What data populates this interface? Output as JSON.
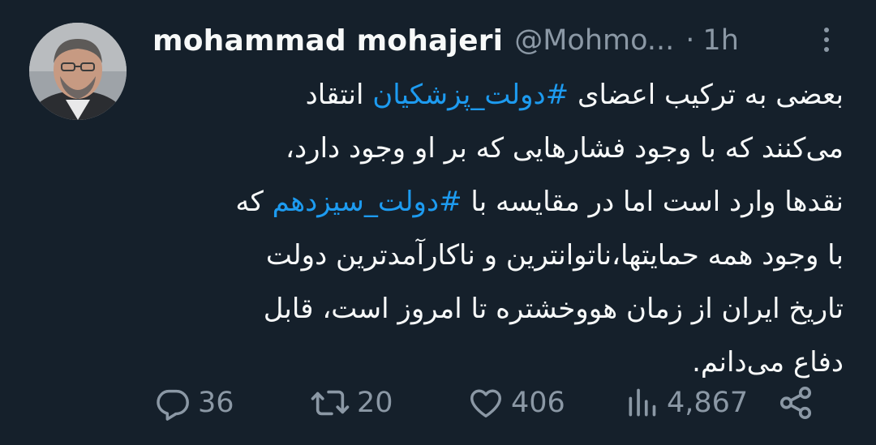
{
  "tweet": {
    "author_name": "mohammad mohajeri",
    "handle": "@Mohmo...",
    "separator": "·",
    "time": "1h",
    "lines": [
      [
        {
          "text": "بعضی به ترکیب اعضای ",
          "hashtag": false
        },
        {
          "text": "#دولت_پزشکیان",
          "hashtag": true
        },
        {
          "text": " انتقاد",
          "hashtag": false
        }
      ],
      [
        {
          "text": "می‌کنند که با وجود فشارهایی که بر او وجود دارد،",
          "hashtag": false
        }
      ],
      [
        {
          "text": "نقدها وارد است اما در مقایسه با ",
          "hashtag": false
        },
        {
          "text": "#دولت_سیزدهم",
          "hashtag": true
        },
        {
          "text": " که",
          "hashtag": false
        }
      ],
      [
        {
          "text": "با وجود همه حمایتها،ناتوانترین و ناکارآمدترین دولت",
          "hashtag": false
        }
      ],
      [
        {
          "text": "تاریخ ایران از زمان هووخشتره  تا امروز است، قابل",
          "hashtag": false
        }
      ],
      [
        {
          "text": "دفاع می‌دانم.",
          "hashtag": false
        }
      ]
    ]
  },
  "actions": {
    "replies": "36",
    "retweets": "20",
    "likes": "406",
    "views": "4,867"
  },
  "icons": {
    "reply": "comment-icon",
    "retweet": "retweet-icon",
    "like": "heart-icon",
    "views": "views-chart-icon",
    "share": "share-icon",
    "more": "more-vertical-icon"
  },
  "colors": {
    "background": "#15202b",
    "text": "#f7f9f9",
    "muted": "#8b98a5",
    "link": "#1d9bf0"
  }
}
